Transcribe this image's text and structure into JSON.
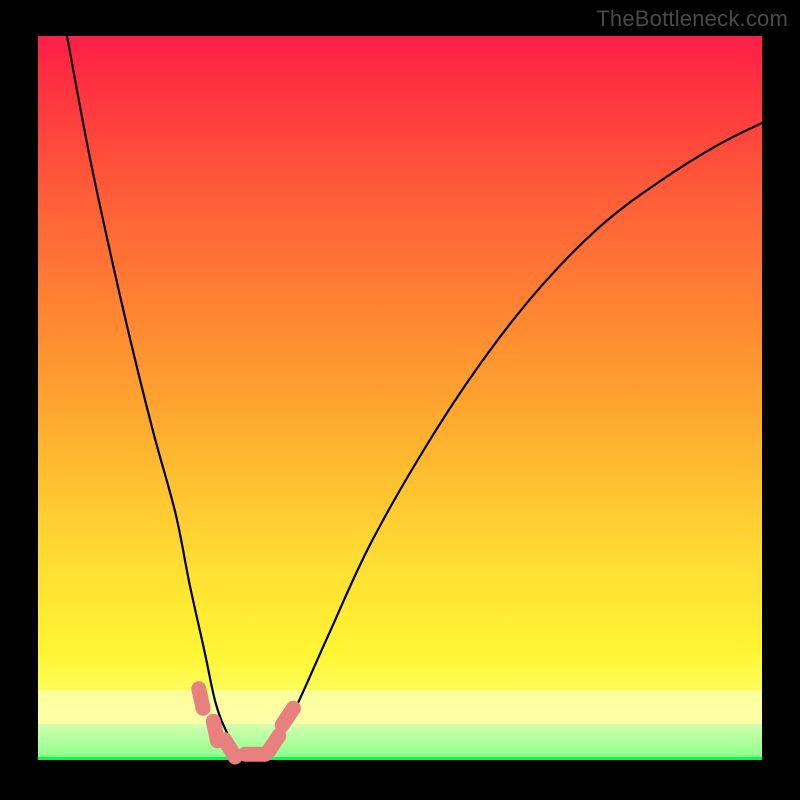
{
  "attribution": "TheBottleneck.com",
  "colors": {
    "gradient_top": "#ff1f47",
    "gradient_mid": "#ffc231",
    "gradient_bottom_band": "#fdff9e",
    "bright_green": "#00ff4b",
    "marker": "#e98080",
    "curve": "#000000",
    "frame": "#000000"
  },
  "chart_data": {
    "type": "line",
    "title": "",
    "xlabel": "",
    "ylabel": "",
    "xlim": [
      0,
      100
    ],
    "ylim": [
      0,
      100
    ],
    "grid": false,
    "legend": false,
    "series": [
      {
        "name": "bottleneck-curve",
        "x": [
          4,
          7,
          10,
          13,
          16,
          19,
          21,
          23,
          24.5,
          26,
          27.5,
          29,
          30.5,
          32,
          35,
          40,
          46,
          54,
          62,
          70,
          78,
          86,
          94,
          100
        ],
        "values": [
          100,
          84,
          70,
          57,
          45,
          34,
          24,
          15,
          8,
          4,
          1.5,
          0.6,
          0.6,
          1.5,
          6,
          17,
          30,
          44,
          56,
          66,
          74,
          80,
          85,
          88
        ]
      }
    ],
    "markers": [
      {
        "x": 22.5,
        "y": 8.5
      },
      {
        "x": 24.5,
        "y": 4.0
      },
      {
        "x": 26.5,
        "y": 1.6
      },
      {
        "x": 30.0,
        "y": 0.8
      },
      {
        "x": 32.5,
        "y": 2.2
      },
      {
        "x": 34.5,
        "y": 6.0
      }
    ]
  }
}
